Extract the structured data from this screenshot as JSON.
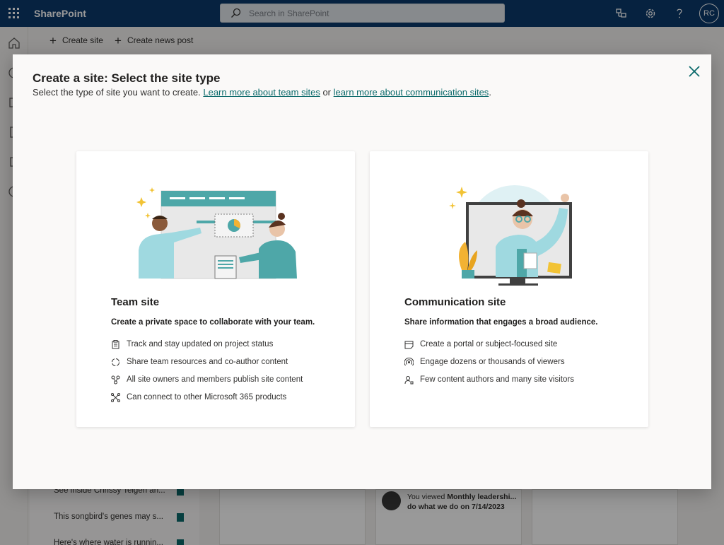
{
  "suite": {
    "brand": "SharePoint",
    "search_placeholder": "Search in SharePoint",
    "avatar_initials": "RC"
  },
  "commands": {
    "create_site": "Create site",
    "create_news_post": "Create news post"
  },
  "background": {
    "news": [
      "See inside Chrissy Teigen an...",
      "This songbird's genes may s...",
      "Here's where water is runnin..."
    ],
    "activity": {
      "line1_prefix": "You viewed ",
      "line1_strong": "Monthly leadershi...",
      "line2": "do what we do on 7/14/2023"
    }
  },
  "modal": {
    "title": "Create a site: Select the site type",
    "subtitle_prefix": "Select the type of site you want to create. ",
    "link_team": "Learn more about team sites",
    "subtitle_or": " or ",
    "link_comm": "learn more about communication sites",
    "subtitle_end": ".",
    "cards": [
      {
        "title": "Team site",
        "description": "Create a private space to collaborate with your team.",
        "features": [
          {
            "icon": "clipboard-icon",
            "text": "Track and stay updated on project status"
          },
          {
            "icon": "sync-icon",
            "text": "Share team resources and co-author content"
          },
          {
            "icon": "people-network-icon",
            "text": "All site owners and members publish site content"
          },
          {
            "icon": "connector-icon",
            "text": "Can connect to other Microsoft 365 products"
          }
        ]
      },
      {
        "title": "Communication site",
        "description": "Share information that engages a broad audience.",
        "features": [
          {
            "icon": "portal-icon",
            "text": "Create a portal or subject-focused site"
          },
          {
            "icon": "broadcast-icon",
            "text": "Engage dozens or thousands of viewers"
          },
          {
            "icon": "person-key-icon",
            "text": "Few content authors and many site visitors"
          }
        ]
      }
    ]
  },
  "colors": {
    "suitebar": "#0a3a6b",
    "accent": "#0b6a6b",
    "illustration_teal": "#4ea7a8",
    "illustration_light": "#dff1f4"
  }
}
